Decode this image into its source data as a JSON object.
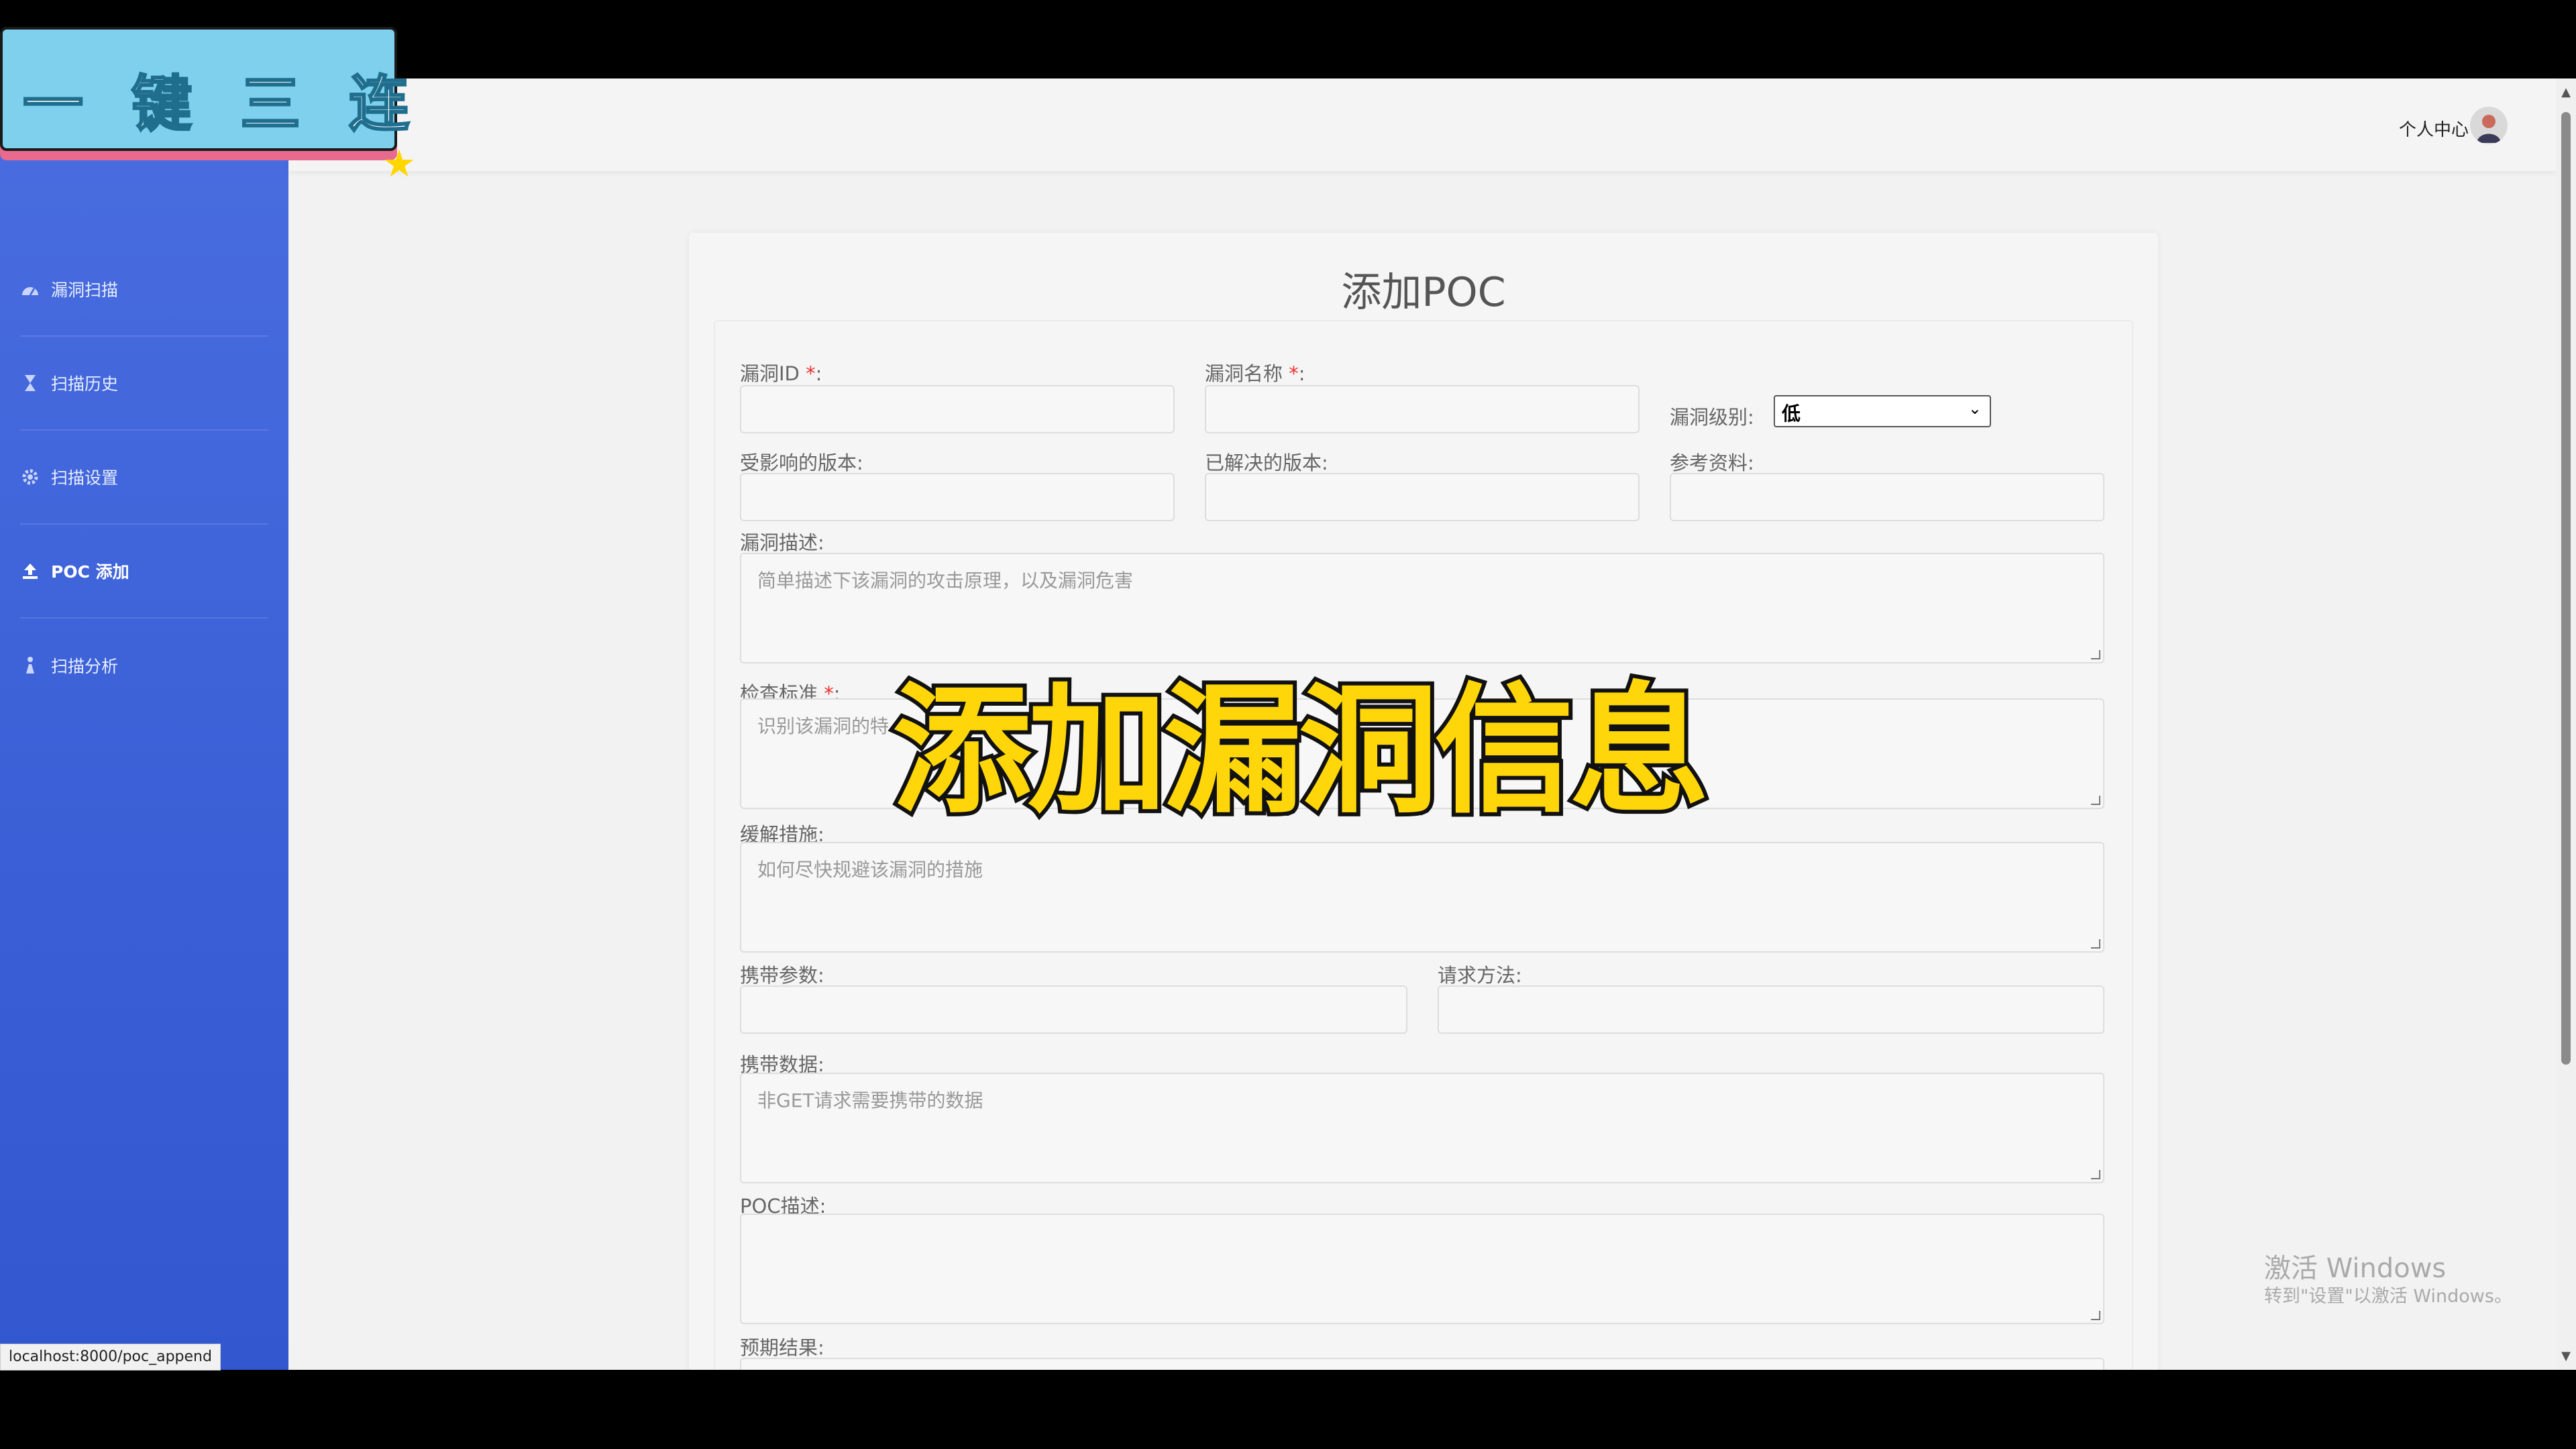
{
  "header": {
    "user_center": "个人中心"
  },
  "sidebar": {
    "items": [
      {
        "label": "漏洞扫描",
        "icon": "dashboard-icon"
      },
      {
        "label": "扫描历史",
        "icon": "hourglass-icon"
      },
      {
        "label": "扫描设置",
        "icon": "gear-icon"
      },
      {
        "label": "POC 添加",
        "icon": "upload-icon"
      },
      {
        "label": "扫描分析",
        "icon": "analysis-icon"
      }
    ]
  },
  "form": {
    "title": "添加POC",
    "vuln_id_label": "漏洞ID",
    "vuln_name_label": "漏洞名称",
    "required_mark": "*",
    "colon": ":",
    "vuln_level_label": "漏洞级别:",
    "vuln_level_value": "低",
    "affected_version_label": "受影响的版本:",
    "resolved_version_label": "已解决的版本:",
    "reference_label": "参考资料:",
    "description_label": "漏洞描述:",
    "description_placeholder": "简单描述下该漏洞的攻击原理，以及漏洞危害",
    "check_label": "检查标准",
    "check_placeholder": "识别该漏洞的特",
    "mitigation_label": "缓解措施:",
    "mitigation_placeholder": "如何尽快规避该漏洞的措施",
    "params_label": "携带参数:",
    "method_label": "请求方法:",
    "data_label": "携带数据:",
    "data_placeholder": "非GET请求需要携带的数据",
    "poc_desc_label": "POC描述:",
    "expected_label": "预期结果:"
  },
  "overlay": {
    "banner": "一键三连",
    "caption": "添加漏洞信息",
    "watermark_title": "激活 Windows",
    "watermark_sub": "转到\"设置\"以激活 Windows。",
    "status_url": "localhost:8000/poc_append"
  }
}
